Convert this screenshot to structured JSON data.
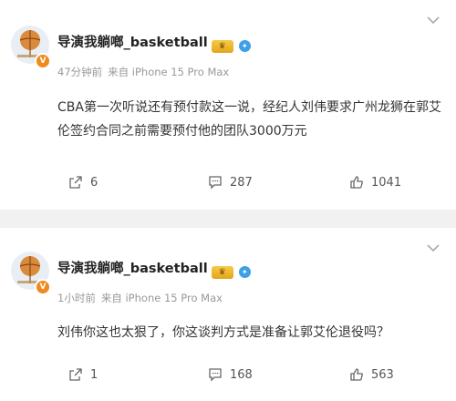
{
  "posts": [
    {
      "author": "导演我躺啷_basketball",
      "time": "47分钟前",
      "source": "来自 iPhone 15 Pro Max",
      "text": "CBA第一次听说还有预付款这一说，经纪人刘伟要求广州龙狮在郭艾伦签约合同之前需要预付他的团队3000万元",
      "shares": "6",
      "comments": "287",
      "likes": "1041"
    },
    {
      "author": "导演我躺啷_basketball",
      "time": "1小时前",
      "source": "来自 iPhone 15 Pro Max",
      "text": "刘伟你这也太狠了，你这谈判方式是准备让郭艾伦退役吗？",
      "shares": "1",
      "comments": "168",
      "likes": "563"
    }
  ],
  "icons": {
    "share": "share-icon",
    "comment": "comment-icon",
    "like": "like-icon",
    "more": "chevron-down-icon"
  },
  "colors": {
    "accent": "#f08a1d",
    "divider": "#f1f1f1"
  }
}
